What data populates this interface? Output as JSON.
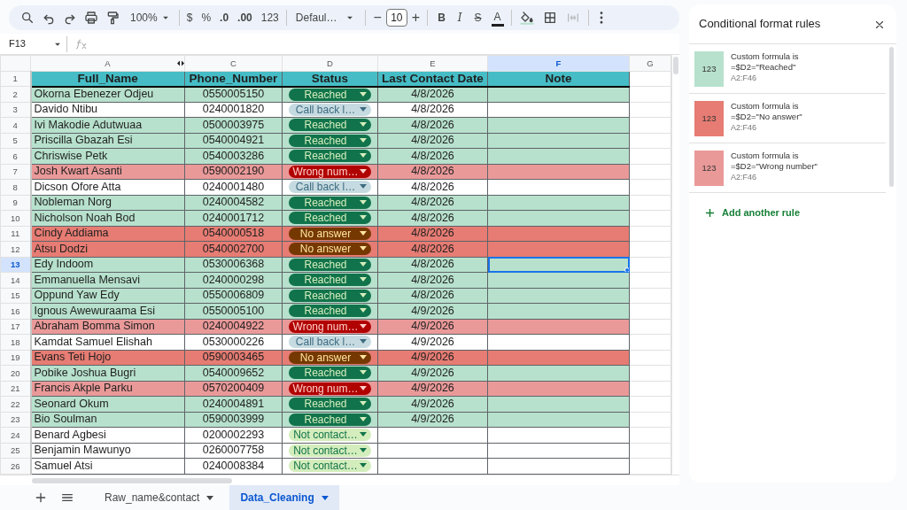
{
  "toolbar": {
    "zoom": "100%",
    "currency": "$",
    "percent": "%",
    "decrease_decimal": ".0",
    "increase_decimal": ".00",
    "more_formats": "123",
    "font": "Defaul…",
    "decrease_size": "−",
    "font_size": "10",
    "increase_size": "+",
    "bold": "B",
    "italic": "I",
    "strikethrough": "S",
    "text_color": "A"
  },
  "formula_bar": {
    "name_box": "F13"
  },
  "columns": [
    {
      "label": "A",
      "selected": false,
      "hidden_after": true
    },
    {
      "label": "C",
      "selected": false,
      "hidden_after": false
    },
    {
      "label": "D",
      "selected": false,
      "hidden_after": false
    },
    {
      "label": "E",
      "selected": false,
      "hidden_after": false
    },
    {
      "label": "F",
      "selected": true,
      "hidden_after": false
    },
    {
      "label": "G",
      "selected": false,
      "hidden_after": false
    }
  ],
  "header_row": {
    "number": "1",
    "cells": [
      "Full_Name",
      "Phone_Number",
      "Status",
      "Last Contact Date",
      "Note"
    ]
  },
  "rows": [
    {
      "number": "2",
      "name": "Okorna Ebenezer Odjeu",
      "phone": "0550005150",
      "status": "Reached",
      "kind": "reached",
      "date": "4/8/2026",
      "selected": false
    },
    {
      "number": "3",
      "name": "Davido Ntibu",
      "phone": "0240001820",
      "status": "Call back l…",
      "kind": "callback",
      "date": "4/8/2026",
      "selected": false
    },
    {
      "number": "4",
      "name": "Ivi Makodie Adutwuaa",
      "phone": "0500003975",
      "status": "Reached",
      "kind": "reached",
      "date": "4/8/2026",
      "selected": false
    },
    {
      "number": "5",
      "name": "Priscilla Gbazah Esi",
      "phone": "0540004921",
      "status": "Reached",
      "kind": "reached",
      "date": "4/8/2026",
      "selected": false
    },
    {
      "number": "6",
      "name": "Chriswise Petk",
      "phone": "0540003286",
      "status": "Reached",
      "kind": "reached",
      "date": "4/8/2026",
      "selected": false
    },
    {
      "number": "7",
      "name": "Josh Kwart Asanti",
      "phone": "0590002190",
      "status": "Wrong num…",
      "kind": "wrong",
      "date": "4/8/2026",
      "selected": false
    },
    {
      "number": "8",
      "name": "Dicson Ofore Atta",
      "phone": "0240001480",
      "status": "Call back l…",
      "kind": "callback",
      "date": "4/8/2026",
      "selected": false
    },
    {
      "number": "9",
      "name": "Nobleman Norg",
      "phone": "0240004582",
      "status": "Reached",
      "kind": "reached",
      "date": "4/8/2026",
      "selected": false
    },
    {
      "number": "10",
      "name": "Nicholson Noah Bod",
      "phone": "0240001712",
      "status": "Reached",
      "kind": "reached",
      "date": "4/8/2026",
      "selected": false
    },
    {
      "number": "11",
      "name": "Cindy Addiama",
      "phone": "0540000518",
      "status": "No answer",
      "kind": "noanswer",
      "date": "4/8/2026",
      "selected": false
    },
    {
      "number": "12",
      "name": "Atsu Dodzi",
      "phone": "0540002700",
      "status": "No answer",
      "kind": "noanswer",
      "date": "4/8/2026",
      "selected": false
    },
    {
      "number": "13",
      "name": "Edy Indoom",
      "phone": "0530006368",
      "status": "Reached",
      "kind": "reached",
      "date": "4/8/2026",
      "selected": true
    },
    {
      "number": "14",
      "name": "Emmanuella Mensavi",
      "phone": "0240000298",
      "status": "Reached",
      "kind": "reached",
      "date": "4/8/2026",
      "selected": false
    },
    {
      "number": "15",
      "name": "Oppund Yaw Edy",
      "phone": "0550006809",
      "status": "Reached",
      "kind": "reached",
      "date": "4/8/2026",
      "selected": false
    },
    {
      "number": "16",
      "name": "Ignous Awewuraama Esi",
      "phone": "0550005100",
      "status": "Reached",
      "kind": "reached",
      "date": "4/9/2026",
      "selected": false
    },
    {
      "number": "17",
      "name": "Abraham Bomma Simon",
      "phone": "0240004922",
      "status": "Wrong num…",
      "kind": "wrong",
      "date": "4/9/2026",
      "selected": false
    },
    {
      "number": "18",
      "name": "Kamdat Samuel Elishah",
      "phone": "0530000226",
      "status": "Call back l…",
      "kind": "callback",
      "date": "4/9/2026",
      "selected": false
    },
    {
      "number": "19",
      "name": "Evans Teti Hojo",
      "phone": "0590003465",
      "status": "No answer",
      "kind": "noanswer",
      "date": "4/9/2026",
      "selected": false
    },
    {
      "number": "20",
      "name": "Pobike Joshua Bugri",
      "phone": "0540009652",
      "status": "Reached",
      "kind": "reached",
      "date": "4/9/2026",
      "selected": false
    },
    {
      "number": "21",
      "name": "Francis Akple Parku",
      "phone": "0570200409",
      "status": "Wrong num…",
      "kind": "wrong",
      "date": "4/9/2026",
      "selected": false
    },
    {
      "number": "22",
      "name": "Seonard Okum",
      "phone": "0240004891",
      "status": "Reached",
      "kind": "reached",
      "date": "4/9/2026",
      "selected": false
    },
    {
      "number": "23",
      "name": "Bio Soulman",
      "phone": "0590003999",
      "status": "Reached",
      "kind": "reached",
      "date": "4/9/2026",
      "selected": false
    },
    {
      "number": "24",
      "name": "Benard Agbesi",
      "phone": "0200002293",
      "status": "Not contact…",
      "kind": "notcontacted",
      "selected": false
    },
    {
      "number": "25",
      "name": "Benjamin Mawunyo",
      "phone": "0260007758",
      "status": "Not contact…",
      "kind": "notcontacted",
      "selected": false
    },
    {
      "number": "26",
      "name": "Samuel Atsi",
      "phone": "0240008384",
      "status": "Not contact…",
      "kind": "notcontacted",
      "selected": false
    }
  ],
  "sheet_tabs": [
    {
      "label": "Raw_name&contact",
      "selected": false
    },
    {
      "label": "Data_Cleaning",
      "selected": true
    }
  ],
  "panel": {
    "title": "Conditional format rules",
    "rules": [
      {
        "sample": "123",
        "color": "#b7e1cd",
        "condition": "Custom formula is",
        "formula": "=$D2=\"Reached\"",
        "range": "A2:F46"
      },
      {
        "sample": "123",
        "color": "#e67c73",
        "condition": "Custom formula is",
        "formula": "=$D2=\"No answer\"",
        "range": "A2:F46"
      },
      {
        "sample": "123",
        "color": "#ea9999",
        "condition": "Custom formula is",
        "formula": "=$D2=\"Wrong number\"",
        "range": "A2:F46"
      }
    ],
    "add_rule": "Add another rule"
  }
}
